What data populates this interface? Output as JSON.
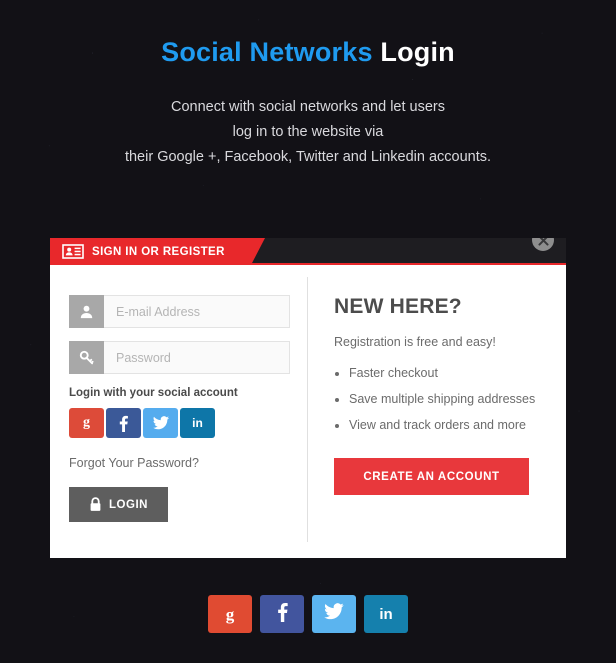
{
  "hero": {
    "title_accent": "Social Networks",
    "title_plain": "Login",
    "desc_line1": "Connect with social networks and let users",
    "desc_line2": "log in to the website via",
    "desc_line3": "their Google +, Facebook, Twitter and Linkedin accounts."
  },
  "card": {
    "header_tab_label": "SIGN IN OR REGISTER",
    "header_icon": "id-card-icon",
    "close_icon": "close-icon"
  },
  "login_form": {
    "email": {
      "placeholder": "E-mail Address",
      "value": "",
      "icon": "user-icon"
    },
    "password": {
      "placeholder": "Password",
      "value": "",
      "icon": "key-icon"
    },
    "social_label": "Login with your social account",
    "forgot_label": "Forgot Your Password?",
    "submit_label": "LOGIN",
    "submit_icon": "lock-icon"
  },
  "social_buttons": [
    {
      "name": "google-plus",
      "glyph": "g",
      "color": "#dd4b39"
    },
    {
      "name": "facebook",
      "glyph": "f",
      "color": "#3b5998"
    },
    {
      "name": "twitter",
      "glyph": "t",
      "color": "#55acee"
    },
    {
      "name": "linkedin",
      "glyph": "in",
      "color": "#0e76a8"
    }
  ],
  "bottom_social_buttons": [
    {
      "name": "google-plus",
      "glyph": "g",
      "color": "#e04b32"
    },
    {
      "name": "facebook",
      "glyph": "f",
      "color": "#42559e"
    },
    {
      "name": "twitter",
      "glyph": "t",
      "color": "#5bb4ef"
    },
    {
      "name": "linkedin",
      "glyph": "in",
      "color": "#1580ad"
    }
  ],
  "new_here": {
    "title": "NEW HERE?",
    "subtitle": "Registration is free and easy!",
    "benefits": [
      "Faster checkout",
      "Save multiple shipping addresses",
      "View and track orders and more"
    ],
    "cta_label": "CREATE AN ACCOUNT"
  },
  "colors": {
    "background": "#121116",
    "accent_blue": "#1f9bf0",
    "accent_red": "#e8282b",
    "cta_red": "#e8383c",
    "header_dark": "#1e1d21",
    "login_gray": "#5e5e5e"
  }
}
